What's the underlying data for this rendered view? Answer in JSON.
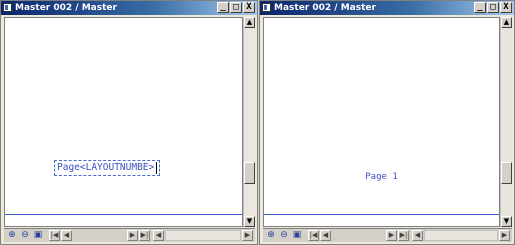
{
  "left_window": {
    "title": "Master 002 / Master",
    "field_text": "Page<LAYOUTNUMBE>"
  },
  "right_window": {
    "title": "Master 002 / Master",
    "page_text": "Page 1"
  },
  "window_controls": {
    "minimize": "_",
    "maximize": "□",
    "close": "X"
  },
  "scroll_arrows": {
    "up": "▲",
    "down": "▼",
    "left": "◀",
    "right": "▶"
  },
  "nav_glyphs": {
    "first": "|◀",
    "prev": "◀",
    "next": "▶",
    "last": "▶|"
  },
  "status_icons": {
    "zoom_in": "⊕",
    "zoom_out": "⊖",
    "view": "▣"
  }
}
